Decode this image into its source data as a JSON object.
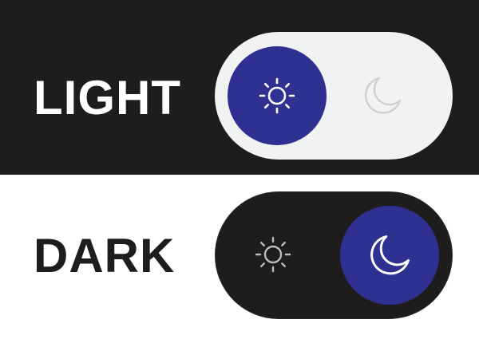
{
  "labels": {
    "light": "LIGHT",
    "dark": "DARK"
  },
  "toggles": [
    {
      "mode": "light",
      "state": "on",
      "active_icon": "sun-icon",
      "inactive_icon": "moon-icon"
    },
    {
      "mode": "dark",
      "state": "on",
      "active_icon": "moon-icon",
      "inactive_icon": "sun-icon"
    }
  ],
  "colors": {
    "accent": "#2e3192",
    "dark_background": "#1e1c1d",
    "light_track": "#f1f2f2",
    "white": "#ffffff",
    "inactive_icon_on_light": "#cfd0d0",
    "inactive_icon_on_dark": "#bdbdbd"
  }
}
